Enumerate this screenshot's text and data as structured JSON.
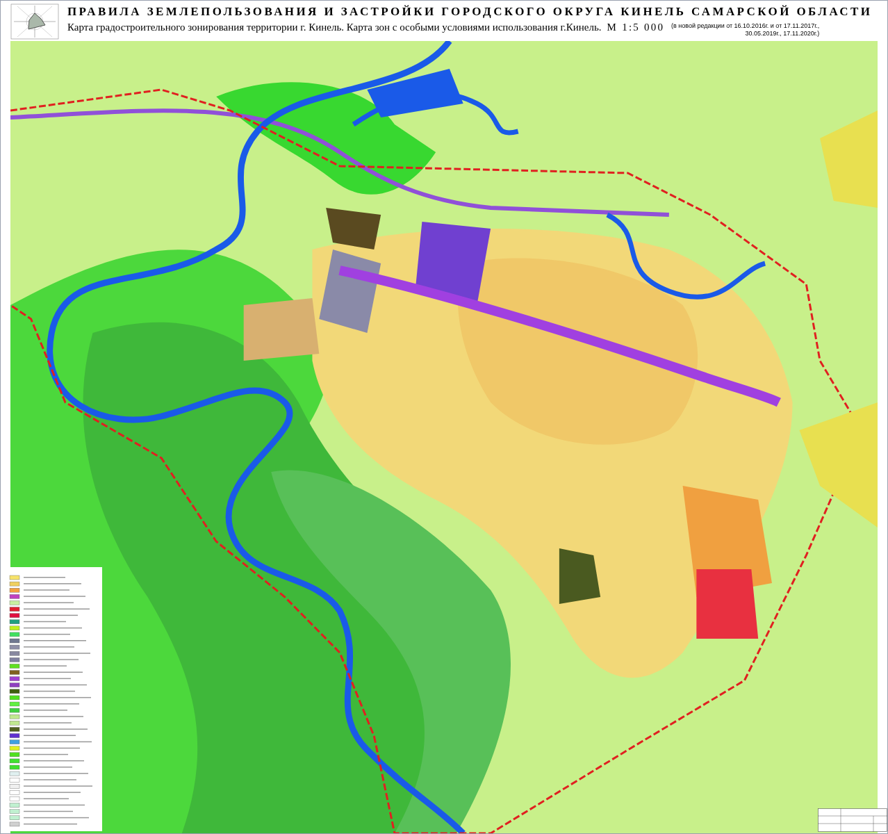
{
  "header": {
    "title": "ПРАВИЛА ЗЕМЛЕПОЛЬЗОВАНИЯ И ЗАСТРОЙКИ ГОРОДСКОГО ОКРУГА КИНЕЛЬ САМАРСКОЙ ОБЛАСТИ",
    "subtitle": "Карта градостроительного зонирования территории г. Кинель. Карта  зон с особыми условиями использования г.Кинель.",
    "scale": "М  1:5  000",
    "edition_note": "(в новой редакции от 16.10.2016г. и от 17.11.2017г., 30.05.2019г., 17.11.2020г.)"
  }
}
